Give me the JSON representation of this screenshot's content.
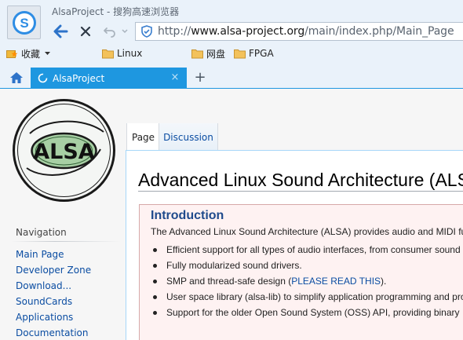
{
  "window": {
    "title": "AlsaProject - 搜狗高速浏览器",
    "address": {
      "scheme": "http://",
      "host": "www.alsa-project.org",
      "path": "/main/index.php/Main_Page"
    }
  },
  "bookmarks": [
    {
      "label": "收藏",
      "icon": "star-folder-icon"
    },
    {
      "label": "Linux",
      "icon": "folder-icon"
    },
    {
      "label": "网盘",
      "icon": "folder-icon"
    },
    {
      "label": "FPGA",
      "icon": "folder-icon"
    }
  ],
  "tabs": {
    "active": {
      "label": "AlsaProject",
      "close": "×"
    },
    "new_tab": "+"
  },
  "wiki": {
    "logo_text": "ALSA",
    "navigation": {
      "heading": "Navigation",
      "items": [
        "Main Page",
        "Developer Zone",
        "Download...",
        "SoundCards",
        "Applications",
        "Documentation"
      ]
    },
    "content_tabs": [
      "Page",
      "Discussion"
    ],
    "page_title": "Advanced Linux Sound Architecture (ALSA)",
    "intro": {
      "title": "Introduction",
      "lead": "The Advanced Linux Sound Architecture (ALSA) provides audio and MIDI functionality",
      "bullets": [
        {
          "text": "Efficient support for all types of audio interfaces, from consumer sound cards"
        },
        {
          "text": "Fully modularized sound drivers."
        },
        {
          "before": "SMP and thread-safe design (",
          "link": "PLEASE READ THIS",
          "after": ")."
        },
        {
          "text": "User space library (alsa-lib) to simplify application programming and provide"
        },
        {
          "text": "Support for the older Open Sound System (OSS) API, providing binary"
        }
      ]
    }
  },
  "colors": {
    "chrome_bg": "#eaf2fa",
    "tab_accent": "#1e97e0",
    "link": "#0b4da2",
    "intro_bg": "#fef2f2",
    "intro_border": "#d6a9a9",
    "intro_title": "#1f4a8c"
  }
}
